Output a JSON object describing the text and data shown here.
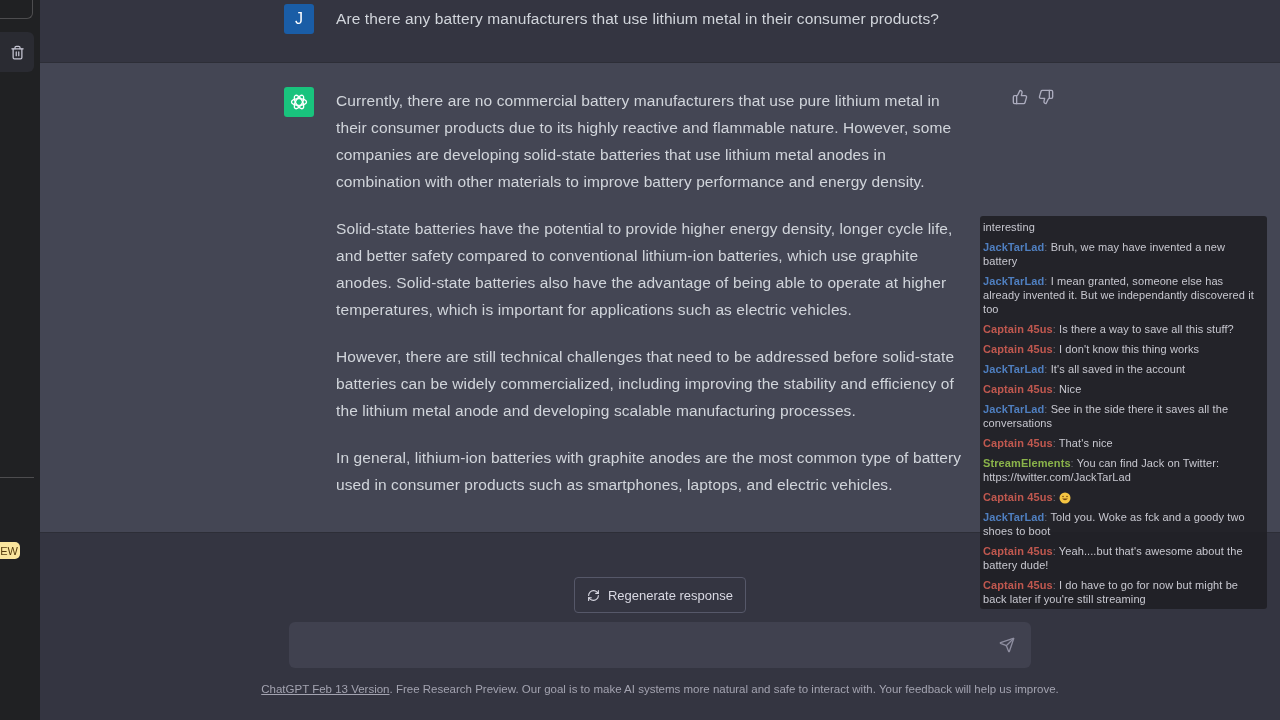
{
  "sidebar": {
    "badge": "EW"
  },
  "conversation": [
    {
      "kind": "user",
      "avatar": "J",
      "paragraphs": [
        "Are there any battery manufacturers that use lithium metal in their consumer products?"
      ]
    },
    {
      "kind": "assistant",
      "paragraphs": [
        "Currently, there are no commercial battery manufacturers that use pure lithium metal in their consumer products due to its highly reactive and flammable nature. However, some companies are developing solid-state batteries that use lithium metal anodes in combination with other materials to improve battery performance and energy density.",
        "Solid-state batteries have the potential to provide higher energy density, longer cycle life, and better safety compared to conventional lithium-ion batteries, which use graphite anodes. Solid-state batteries also have the advantage of being able to operate at higher temperatures, which is important for applications such as electric vehicles.",
        "However, there are still technical challenges that need to be addressed before solid-state batteries can be widely commercialized, including improving the stability and efficiency of the lithium metal anode and developing scalable manufacturing processes.",
        "In general, lithium-ion batteries with graphite anodes are the most common type of battery used in consumer products such as smartphones, laptops, and electric vehicles."
      ]
    }
  ],
  "regenerate_button": "Regenerate response",
  "footer": {
    "link": "ChatGPT Feb 13 Version",
    "text": ". Free Research Preview. Our goal is to make AI systems more natural and safe to interact with. Your feedback will help us improve."
  },
  "stream_chat": [
    {
      "kind": "text",
      "text": "interesting"
    },
    {
      "kind": "text",
      "author": "JackTarLad",
      "separator": ":",
      "color": "#4f7fc0",
      "text": "Bruh, we may have invented a new battery"
    },
    {
      "kind": "text",
      "author": "JackTarLad",
      "separator": ":",
      "color": "#4f7fc0",
      "text": "I mean granted, someone else has already invented it. But we independantly discovered it too"
    },
    {
      "kind": "text",
      "author": "Captain 45us",
      "separator": ":",
      "color": "#c0584f",
      "text": "Is there a way to save all this stuff?"
    },
    {
      "kind": "text",
      "author": "Captain 45us",
      "separator": ":",
      "color": "#c0584f",
      "text": "I don't know this thing works"
    },
    {
      "kind": "text",
      "author": "JackTarLad",
      "separator": ":",
      "color": "#4f7fc0",
      "text": "It's all saved in the account"
    },
    {
      "kind": "text",
      "author": "Captain 45us",
      "separator": ":",
      "color": "#c0584f",
      "text": "Nice"
    },
    {
      "kind": "text",
      "author": "JackTarLad",
      "separator": ":",
      "color": "#4f7fc0",
      "text": "See in the side there it saves all the conversations"
    },
    {
      "kind": "text",
      "author": "Captain 45us",
      "separator": ":",
      "color": "#c0584f",
      "text": "That's nice"
    },
    {
      "kind": "text",
      "author": "StreamElements",
      "separator": ":",
      "color": "#8ab34a",
      "text": "You can find Jack on Twitter: https://twitter.com/JackTarLad"
    },
    {
      "kind": "emote",
      "author": "Captain 45us",
      "separator": ":",
      "color": "#c0584f"
    },
    {
      "kind": "text",
      "author": "JackTarLad",
      "separator": ":",
      "color": "#4f7fc0",
      "text": "Told you. Woke as fck and a goody two shoes to boot"
    },
    {
      "kind": "text",
      "author": "Captain 45us",
      "separator": ":",
      "color": "#c0584f",
      "text": "Yeah....but that's awesome about the battery dude!"
    },
    {
      "kind": "text",
      "author": "Captain 45us",
      "separator": ":",
      "color": "#c0584f",
      "text": "I do have to go for now but might be back later if you're still streaming"
    }
  ]
}
